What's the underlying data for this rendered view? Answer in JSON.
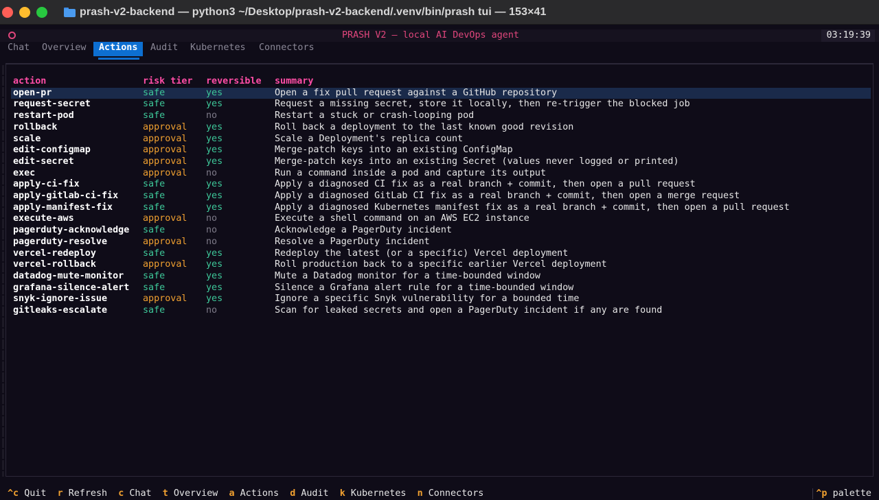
{
  "window": {
    "title": "prash-v2-backend — python3 ~/Desktop/prash-v2-backend/.venv/bin/prash tui — 153×41"
  },
  "header": {
    "title": "PRASH V2 — local AI DevOps agent",
    "clock": "03:19:39"
  },
  "tabs": [
    {
      "label": "Chat",
      "active": false
    },
    {
      "label": "Overview",
      "active": false
    },
    {
      "label": "Actions",
      "active": true
    },
    {
      "label": "Audit",
      "active": false
    },
    {
      "label": "Kubernetes",
      "active": false
    },
    {
      "label": "Connectors",
      "active": false
    }
  ],
  "table": {
    "columns": [
      "action",
      "risk tier",
      "reversible",
      "summary"
    ],
    "rows": [
      {
        "action": "open-pr",
        "tier": "safe",
        "reversible": "yes",
        "summary": "Open a fix pull request against a GitHub repository"
      },
      {
        "action": "request-secret",
        "tier": "safe",
        "reversible": "yes",
        "summary": "Request a missing secret, store it locally, then re-trigger the blocked job"
      },
      {
        "action": "restart-pod",
        "tier": "safe",
        "reversible": "no",
        "summary": "Restart a stuck or crash-looping pod"
      },
      {
        "action": "rollback",
        "tier": "approval",
        "reversible": "yes",
        "summary": "Roll back a deployment to the last known good revision"
      },
      {
        "action": "scale",
        "tier": "approval",
        "reversible": "yes",
        "summary": "Scale a Deployment's replica count"
      },
      {
        "action": "edit-configmap",
        "tier": "approval",
        "reversible": "yes",
        "summary": "Merge-patch keys into an existing ConfigMap"
      },
      {
        "action": "edit-secret",
        "tier": "approval",
        "reversible": "yes",
        "summary": "Merge-patch keys into an existing Secret (values never logged or printed)"
      },
      {
        "action": "exec",
        "tier": "approval",
        "reversible": "no",
        "summary": "Run a command inside a pod and capture its output"
      },
      {
        "action": "apply-ci-fix",
        "tier": "safe",
        "reversible": "yes",
        "summary": "Apply a diagnosed CI fix as a real branch + commit, then open a pull request"
      },
      {
        "action": "apply-gitlab-ci-fix",
        "tier": "safe",
        "reversible": "yes",
        "summary": "Apply a diagnosed GitLab CI fix as a real branch + commit, then open a merge request"
      },
      {
        "action": "apply-manifest-fix",
        "tier": "safe",
        "reversible": "yes",
        "summary": "Apply a diagnosed Kubernetes manifest fix as a real branch + commit, then open a pull request"
      },
      {
        "action": "execute-aws",
        "tier": "approval",
        "reversible": "no",
        "summary": "Execute a shell command on an AWS EC2 instance"
      },
      {
        "action": "pagerduty-acknowledge",
        "tier": "safe",
        "reversible": "no",
        "summary": "Acknowledge a PagerDuty incident"
      },
      {
        "action": "pagerduty-resolve",
        "tier": "approval",
        "reversible": "no",
        "summary": "Resolve a PagerDuty incident"
      },
      {
        "action": "vercel-redeploy",
        "tier": "safe",
        "reversible": "yes",
        "summary": "Redeploy the latest (or a specific) Vercel deployment"
      },
      {
        "action": "vercel-rollback",
        "tier": "approval",
        "reversible": "yes",
        "summary": "Roll production back to a specific earlier Vercel deployment"
      },
      {
        "action": "datadog-mute-monitor",
        "tier": "safe",
        "reversible": "yes",
        "summary": "Mute a Datadog monitor for a time-bounded window"
      },
      {
        "action": "grafana-silence-alert",
        "tier": "safe",
        "reversible": "yes",
        "summary": "Silence a Grafana alert rule for a time-bounded window"
      },
      {
        "action": "snyk-ignore-issue",
        "tier": "approval",
        "reversible": "yes",
        "summary": "Ignore a specific Snyk vulnerability for a bounded time"
      },
      {
        "action": "gitleaks-escalate",
        "tier": "safe",
        "reversible": "no",
        "summary": "Scan for leaked secrets and open a PagerDuty incident if any are found"
      }
    ]
  },
  "footer": {
    "bindings": [
      {
        "key": "^c",
        "label": "Quit"
      },
      {
        "key": "r",
        "label": "Refresh"
      },
      {
        "key": "c",
        "label": "Chat"
      },
      {
        "key": "t",
        "label": "Overview"
      },
      {
        "key": "a",
        "label": "Actions"
      },
      {
        "key": "d",
        "label": "Audit"
      },
      {
        "key": "k",
        "label": "Kubernetes"
      },
      {
        "key": "n",
        "label": "Connectors"
      }
    ],
    "palette": {
      "key": "^p",
      "label": "palette"
    }
  },
  "colors": {
    "accent_pink": "#e0467c",
    "active_tab": "#0d6fd1",
    "safe_green": "#3ec99a",
    "approval_orange": "#f0a030",
    "header_magenta": "#ff4da6"
  },
  "icons": {
    "folder": "folder-icon",
    "app": "circle-icon"
  }
}
